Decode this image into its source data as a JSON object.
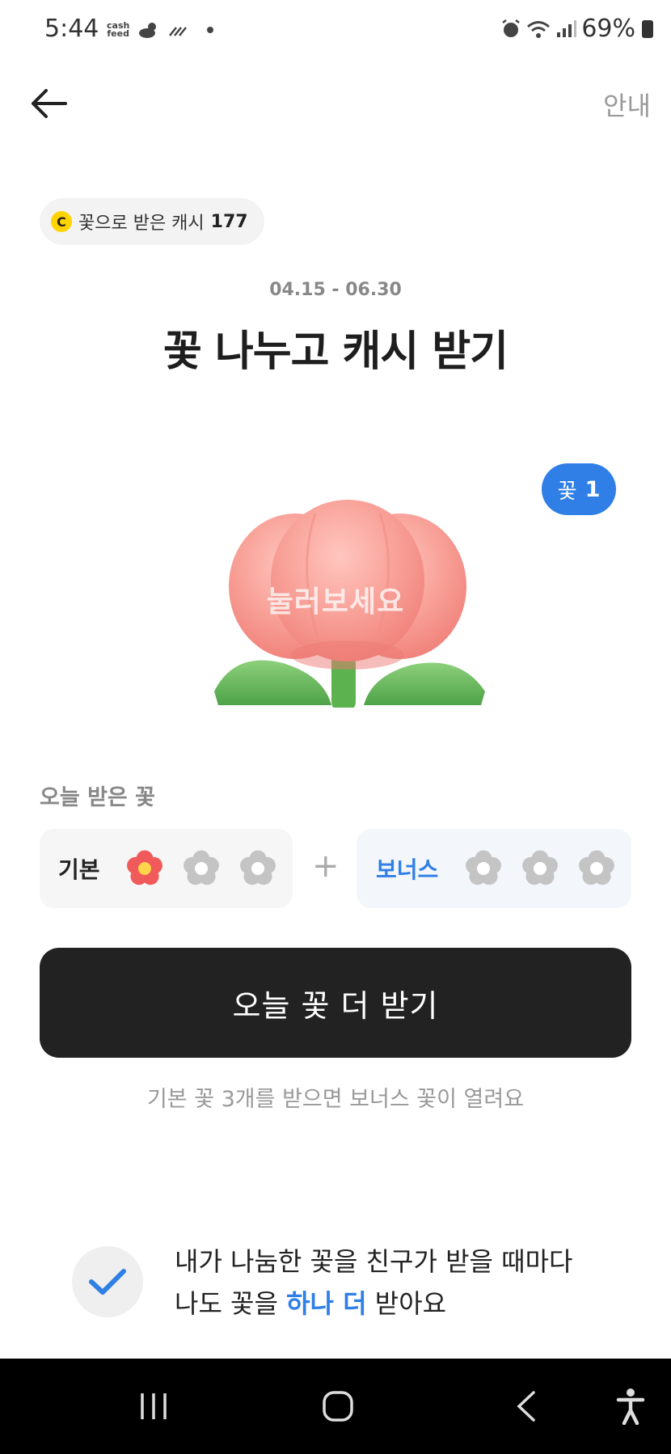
{
  "status_bar": {
    "time": "5:44",
    "cashfeed_line1": "cash",
    "cashfeed_line2": "feed",
    "battery": "69%"
  },
  "header": {
    "guide_label": "안내"
  },
  "cash_chip": {
    "coin_letter": "C",
    "label": "꽃으로 받은 캐시",
    "amount": "177"
  },
  "event": {
    "period": "04.15 - 06.30",
    "title": "꽃 나누고 캐시 받기"
  },
  "flower": {
    "badge_label": "꽃",
    "badge_count": "1",
    "press_text": "눌러보세요"
  },
  "today": {
    "label": "오늘 받은 꽃",
    "basic_label": "기본",
    "basic_received": 1,
    "basic_total": 3,
    "bonus_label": "보너스",
    "bonus_received": 0,
    "bonus_total": 3,
    "plus": "+"
  },
  "cta": {
    "label": "오늘 꽃 더 받기",
    "hint": "기본 꽃 3개를 받으면 보너스 꽃이 열려요"
  },
  "info": {
    "line1": "내가 나눔한 꽃을 친구가 받을 때마다",
    "line2_prefix": "나도 꽃을 ",
    "line2_highlight": "하나 더",
    "line2_suffix": " 받아요"
  },
  "colors": {
    "accent": "#2f7fe6",
    "cta_bg": "#222222",
    "coin": "#ffd400",
    "flower_active": "#f05a5a",
    "flower_inactive": "#c4c4c4"
  }
}
